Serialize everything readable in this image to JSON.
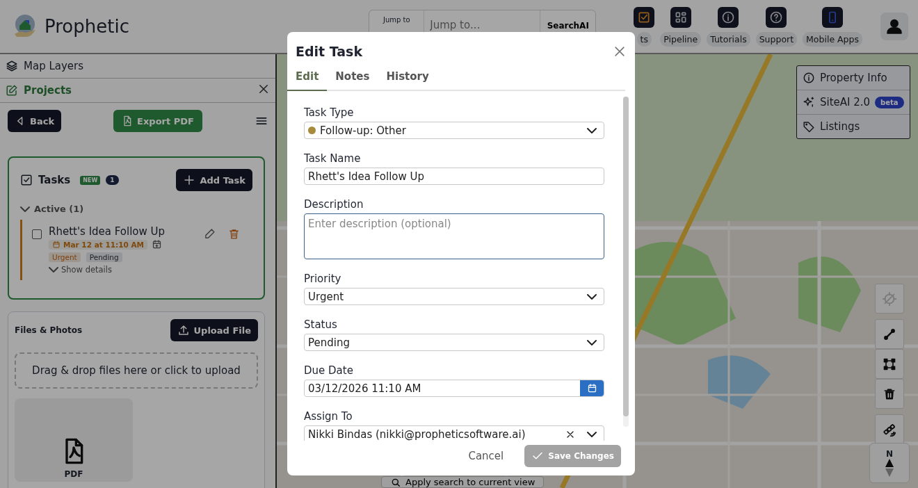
{
  "app": {
    "name": "Prophetic"
  },
  "topbar": {
    "jump_label": "Jump to",
    "search_placeholder": "Jump to...",
    "search_button": "SearchAI",
    "nav": [
      {
        "label": "ts",
        "kind": "tasks"
      },
      {
        "label": "Pipeline",
        "kind": "pipeline"
      },
      {
        "label": "Tutorials",
        "kind": "info"
      },
      {
        "label": "Support",
        "kind": "help"
      },
      {
        "label": "Mobile Apps",
        "kind": "phone"
      }
    ]
  },
  "sidebar": {
    "sections": [
      {
        "label": "Map Layers",
        "kind": "layers",
        "selected": false
      },
      {
        "label": "Projects",
        "kind": "edit",
        "selected": true
      }
    ],
    "back": "Back",
    "export": "Export PDF",
    "tasks": {
      "title": "Tasks",
      "badge": "NEW",
      "count": "1",
      "add": "Add Task",
      "group": {
        "label": "Active (1)",
        "expanded": true
      },
      "items": [
        {
          "name": "Rhett's Idea Follow Up",
          "checked": false,
          "due": "Mar 12 at 11:10 AM",
          "details": "Show details",
          "tags": [
            {
              "label": "Urgent",
              "kind": "priority"
            },
            {
              "label": "Pending",
              "kind": "status"
            }
          ]
        }
      ]
    },
    "files": {
      "title": "Files & Photos",
      "upload": "Upload File",
      "dropzone": "Drag & drop files here or click to upload",
      "items": [
        {
          "type": "PDF"
        }
      ]
    }
  },
  "map": {
    "panel": [
      {
        "label": "Property Info",
        "kind": "info"
      },
      {
        "label": "SiteAI 2.0",
        "kind": "sparkle",
        "badge": "beta"
      },
      {
        "label": "Listings",
        "kind": "tag"
      }
    ],
    "tools": [
      {
        "kind": "no-location",
        "disabled": true
      },
      {
        "kind": "line",
        "disabled": false
      },
      {
        "kind": "polygon",
        "disabled": false
      },
      {
        "kind": "trash",
        "disabled": false
      },
      {
        "kind": "satellite",
        "disabled": false
      }
    ],
    "compass": "N",
    "apply": "Apply search to current view"
  },
  "modal": {
    "title": "Edit Task",
    "tabs": [
      {
        "label": "Edit",
        "selected": true
      },
      {
        "label": "Notes",
        "selected": false
      },
      {
        "label": "History",
        "selected": false
      }
    ],
    "fields": [
      {
        "kind": "select",
        "label": "Task Type",
        "value": "Follow-up: Other",
        "color": "#a98b3c"
      },
      {
        "kind": "text",
        "label": "Task Name",
        "value": "Rhett's Idea Follow Up"
      },
      {
        "kind": "textarea",
        "label": "Description",
        "placeholder": "Enter description (optional)",
        "focused": true
      },
      {
        "kind": "select",
        "label": "Priority",
        "value": "Urgent"
      },
      {
        "kind": "select",
        "label": "Status",
        "value": "Pending"
      },
      {
        "kind": "date",
        "label": "Due Date",
        "value": "03/12/2026 11:10 AM"
      },
      {
        "kind": "select",
        "label": "Assign To",
        "value": "Nikki Bindas (nikki@propheticsoftware.ai)",
        "clearable": true
      }
    ],
    "cancel": "Cancel",
    "save": {
      "label": "Save Changes",
      "disabled": true
    }
  }
}
